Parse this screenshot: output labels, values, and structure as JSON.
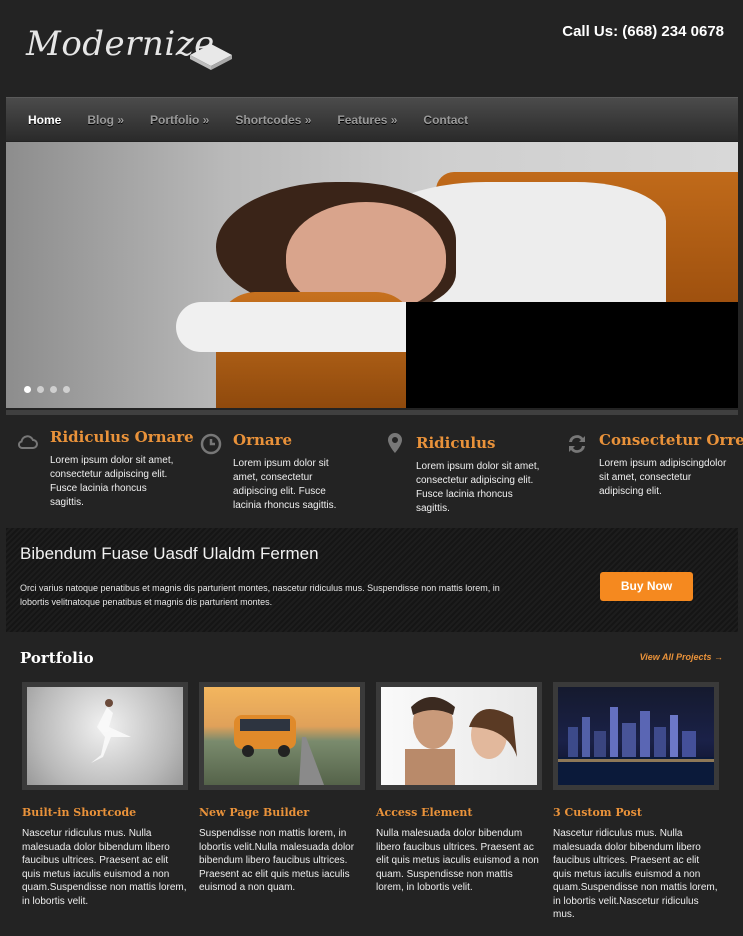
{
  "header": {
    "logo_text": "Modernize",
    "call_text": "Call Us: (668) 234 0678"
  },
  "nav": {
    "items": [
      {
        "label": "Home"
      },
      {
        "label": "Blog »"
      },
      {
        "label": "Portfolio »"
      },
      {
        "label": "Shortcodes »"
      },
      {
        "label": "Features »"
      },
      {
        "label": "Contact"
      }
    ],
    "active": "Home"
  },
  "slider": {
    "dot_count": 4,
    "active_dot": 1
  },
  "features": [
    {
      "icon": "cloud-icon",
      "title": "Ridiculus Ornare",
      "text": "Lorem ipsum dolor sit amet, consectetur adipiscing elit. Fusce lacinia rhoncus sagittis."
    },
    {
      "icon": "clock-icon",
      "title": "Ornare",
      "text": "Lorem ipsum dolor sit amet, consectetur adipiscing elit. Fusce lacinia rhoncus sagittis."
    },
    {
      "icon": "map-pin-icon",
      "title": "Ridiculus",
      "text": "Lorem ipsum dolor sit amet, consectetur adipiscing elit. Fusce lacinia rhoncus sagittis."
    },
    {
      "icon": "refresh-icon",
      "title": "Consectetur Orre",
      "text": "Lorem ipsum adipiscingdolor sit amet, consectetur adipiscing elit."
    }
  ],
  "promo": {
    "title": "Bibendum Fuase Uasdf Ulaldm Fermen",
    "text": "Orci varius natoque penatibus et magnis dis parturient montes, nascetur ridiculus mus. Suspendisse non mattis lorem, in lobortis velitnatoque penatibus et magnis dis parturient montes.",
    "button_label": "Buy Now"
  },
  "portfolio": {
    "title": "Portfolio",
    "view_all": "View All Projects →",
    "items": [
      {
        "title": "Built-in Shortcode",
        "text": "Nascetur ridiculus mus. Nulla malesuada dolor bibendum libero faucibus ultrices. Praesent ac elit quis metus iaculis euismod a non quam.Suspendisse non mattis lorem, in lobortis velit."
      },
      {
        "title": "New Page Builder",
        "text": "Suspendisse non mattis lorem, in lobortis velit.Nulla malesuada dolor bibendum libero faucibus ultrices. Praesent ac elit quis metus iaculis euismod a non quam."
      },
      {
        "title": "Access Element",
        "text": "Nulla malesuada dolor bibendum libero faucibus ultrices. Praesent ac elit quis metus iaculis euismod a non quam. Suspendisse non mattis lorem, in lobortis velit."
      },
      {
        "title": "3 Custom Post",
        "text": "Nascetur ridiculus mus. Nulla malesuada dolor bibendum libero faucibus ultrices. Praesent ac elit quis metus iaculis euismod a non quam.Suspendisse non mattis lorem, in lobortis velit.Nascetur ridiculus mus."
      }
    ]
  },
  "colors": {
    "accent": "#e9923a",
    "button": "#f5891f",
    "background": "#232323"
  }
}
